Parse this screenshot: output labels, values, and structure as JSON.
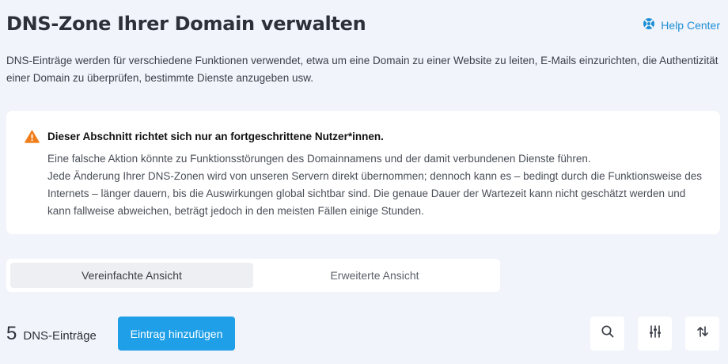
{
  "header": {
    "title": "DNS-Zone Ihrer Domain verwalten",
    "help_label": "Help Center",
    "help_icon": "lifebuoy-icon",
    "accent_color": "#1f8fd6"
  },
  "intro": "DNS-Einträge werden für verschiedene Funktionen verwendet, etwa um eine Domain zu einer Website zu leiten, E-Mails einzurichten, die Authentizität einer Domain zu überprüfen, bestimmte Dienste anzugeben usw.",
  "notice": {
    "icon": "warning-icon",
    "icon_color": "#f07d1a",
    "heading": "Dieser Abschnitt richtet sich nur an fortgeschrittene Nutzer*innen.",
    "line1": "Eine falsche Aktion könnte zu Funktionsstörungen des Domainnamens und der damit verbundenen Dienste führen.",
    "line2": "Jede Änderung Ihrer DNS-Zonen wird von unseren Servern direkt übernommen; dennoch kann es – bedingt durch die Funktionsweise des Internets – länger dauern, bis die Auswirkungen global sichtbar sind. Die genaue Dauer der Wartezeit kann nicht geschätzt werden und kann fallweise abweichen, beträgt jedoch in den meisten Fällen einige Stunden."
  },
  "view_toggle": {
    "simple_label": "Vereinfachte Ansicht",
    "advanced_label": "Erweiterte Ansicht",
    "selected": "simple"
  },
  "records": {
    "count": "5",
    "count_label": "DNS-Einträge",
    "add_label": "Eintrag hinzufügen",
    "button_color": "#1e9fe8"
  },
  "toolbar_icons": [
    "search-icon",
    "filter-sliders-icon",
    "sort-icon"
  ]
}
